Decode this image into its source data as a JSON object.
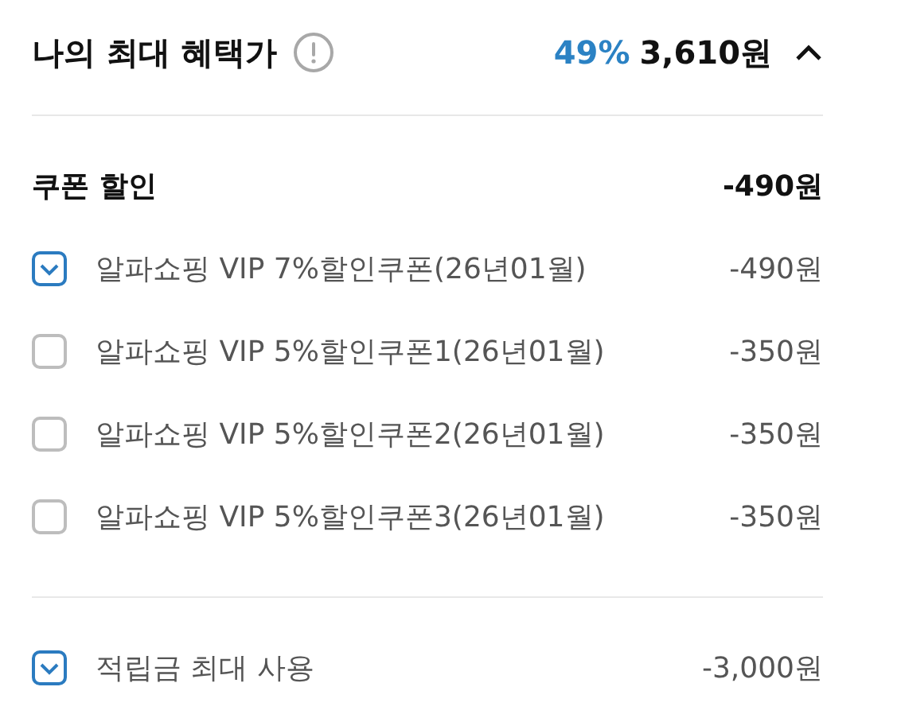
{
  "header": {
    "title": "나의 최대 혜택가",
    "percent": "49%",
    "price": "3,610원",
    "expanded": true
  },
  "coupon_section": {
    "title": "쿠폰 할인",
    "total": "-490원",
    "coupons": [
      {
        "label": "알파쇼핑 VIP 7%할인쿠폰(26년01월)",
        "amount": "-490원",
        "checked": true
      },
      {
        "label": "알파쇼핑 VIP 5%할인쿠폰1(26년01월)",
        "amount": "-350원",
        "checked": false
      },
      {
        "label": "알파쇼핑 VIP 5%할인쿠폰2(26년01월)",
        "amount": "-350원",
        "checked": false
      },
      {
        "label": "알파쇼핑 VIP 5%할인쿠폰3(26년01월)",
        "amount": "-350원",
        "checked": false
      }
    ]
  },
  "points": {
    "label": "적립금 최대 사용",
    "amount": "-3,000원",
    "checked": true
  }
}
